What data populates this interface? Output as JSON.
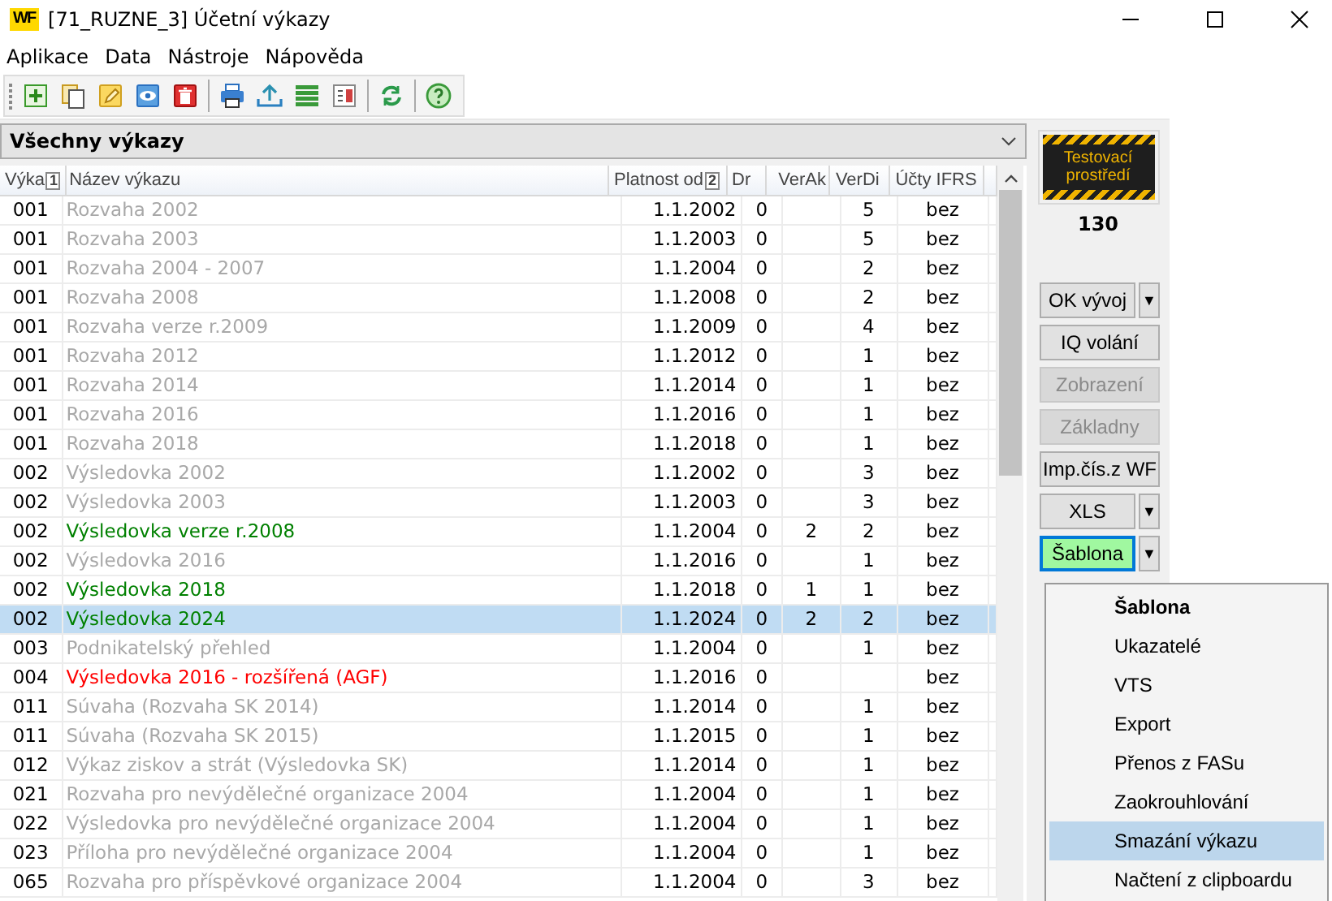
{
  "window": {
    "logo": "WF",
    "title": "[71_RUZNE_3] Účetní výkazy"
  },
  "menu": [
    "Aplikace",
    "Data",
    "Nástroje",
    "Nápověda"
  ],
  "group_header": "Všechny výkazy",
  "table": {
    "columns": [
      {
        "label": "Výka",
        "sort": "1"
      },
      {
        "label": "Název výkazu"
      },
      {
        "label": "Platnost od",
        "sort": "2"
      },
      {
        "label": "Dr"
      },
      {
        "label": "VerAk"
      },
      {
        "label": "VerDi"
      },
      {
        "label": "Účty IFRS"
      }
    ],
    "rows": [
      {
        "code": "001",
        "name": "Rozvaha 2002",
        "valid_from": "1.1.2002",
        "dr": "0",
        "ver_di": "5",
        "ifrs": "bez",
        "color": "#a8a8a8",
        "selected": false
      },
      {
        "code": "001",
        "name": "Rozvaha 2003",
        "valid_from": "1.1.2003",
        "dr": "0",
        "ver_di": "5",
        "ifrs": "bez",
        "color": "#a8a8a8",
        "selected": false
      },
      {
        "code": "001",
        "name": "Rozvaha 2004 - 2007",
        "valid_from": "1.1.2004",
        "dr": "0",
        "ver_di": "2",
        "ifrs": "bez",
        "color": "#a8a8a8",
        "selected": false
      },
      {
        "code": "001",
        "name": "Rozvaha 2008",
        "valid_from": "1.1.2008",
        "dr": "0",
        "ver_di": "2",
        "ifrs": "bez",
        "color": "#a8a8a8",
        "selected": false
      },
      {
        "code": "001",
        "name": "Rozvaha verze r.2009",
        "valid_from": "1.1.2009",
        "dr": "0",
        "ver_di": "4",
        "ifrs": "bez",
        "color": "#a8a8a8",
        "selected": false
      },
      {
        "code": "001",
        "name": "Rozvaha 2012",
        "valid_from": "1.1.2012",
        "dr": "0",
        "ver_di": "1",
        "ifrs": "bez",
        "color": "#a8a8a8",
        "selected": false
      },
      {
        "code": "001",
        "name": "Rozvaha 2014",
        "valid_from": "1.1.2014",
        "dr": "0",
        "ver_di": "1",
        "ifrs": "bez",
        "color": "#a8a8a8",
        "selected": false
      },
      {
        "code": "001",
        "name": "Rozvaha 2016",
        "valid_from": "1.1.2016",
        "dr": "0",
        "ver_di": "1",
        "ifrs": "bez",
        "color": "#a8a8a8",
        "selected": false
      },
      {
        "code": "001",
        "name": "Rozvaha 2018",
        "valid_from": "1.1.2018",
        "dr": "0",
        "ver_di": "1",
        "ifrs": "bez",
        "color": "#a8a8a8",
        "selected": false
      },
      {
        "code": "002",
        "name": "Výsledovka 2002",
        "valid_from": "1.1.2002",
        "dr": "0",
        "ver_di": "3",
        "ifrs": "bez",
        "color": "#a8a8a8",
        "selected": false
      },
      {
        "code": "002",
        "name": "Výsledovka 2003",
        "valid_from": "1.1.2003",
        "dr": "0",
        "ver_di": "3",
        "ifrs": "bez",
        "color": "#a8a8a8",
        "selected": false
      },
      {
        "code": "002",
        "name": "Výsledovka verze r.2008",
        "valid_from": "1.1.2004",
        "dr": "0",
        "ver_ak": "2",
        "ver_di": "2",
        "ifrs": "bez",
        "color": "#008000",
        "selected": false
      },
      {
        "code": "002",
        "name": "Výsledovka 2016",
        "valid_from": "1.1.2016",
        "dr": "0",
        "ver_di": "1",
        "ifrs": "bez",
        "color": "#a8a8a8",
        "selected": false
      },
      {
        "code": "002",
        "name": "Výsledovka 2018",
        "valid_from": "1.1.2018",
        "dr": "0",
        "ver_ak": "1",
        "ver_di": "1",
        "ifrs": "bez",
        "color": "#008000",
        "selected": false
      },
      {
        "code": "002",
        "name": "Výsledovka 2024",
        "valid_from": "1.1.2024",
        "dr": "0",
        "ver_ak": "2",
        "ver_di": "2",
        "ifrs": "bez",
        "color": "#008000",
        "selected": true
      },
      {
        "code": "003",
        "name": "Podnikatelský přehled",
        "valid_from": "1.1.2004",
        "dr": "0",
        "ver_di": "1",
        "ifrs": "bez",
        "color": "#a8a8a8",
        "selected": false
      },
      {
        "code": "004",
        "name": "Výsledovka 2016 - rozšířená (AGF)",
        "valid_from": "1.1.2016",
        "dr": "0",
        "ifrs": "bez",
        "color": "#ff0000",
        "selected": false
      },
      {
        "code": "011",
        "name": "Súvaha (Rozvaha SK 2014)",
        "valid_from": "1.1.2014",
        "dr": "0",
        "ver_di": "1",
        "ifrs": "bez",
        "color": "#a8a8a8",
        "selected": false
      },
      {
        "code": "011",
        "name": "Súvaha (Rozvaha SK 2015)",
        "valid_from": "1.1.2015",
        "dr": "0",
        "ver_di": "1",
        "ifrs": "bez",
        "color": "#a8a8a8",
        "selected": false
      },
      {
        "code": "012",
        "name": "Výkaz ziskov a strát (Výsledovka SK)",
        "valid_from": "1.1.2014",
        "dr": "0",
        "ver_di": "1",
        "ifrs": "bez",
        "color": "#a8a8a8",
        "selected": false
      },
      {
        "code": "021",
        "name": "Rozvaha pro nevýdělečné organizace 2004",
        "valid_from": "1.1.2004",
        "dr": "0",
        "ver_di": "1",
        "ifrs": "bez",
        "color": "#a8a8a8",
        "selected": false
      },
      {
        "code": "022",
        "name": "Výsledovka pro nevýdělečné organizace 2004",
        "valid_from": "1.1.2004",
        "dr": "0",
        "ver_di": "1",
        "ifrs": "bez",
        "color": "#a8a8a8",
        "selected": false
      },
      {
        "code": "023",
        "name": "Příloha pro nevýdělečné organizace 2004",
        "valid_from": "1.1.2004",
        "dr": "0",
        "ver_di": "1",
        "ifrs": "bez",
        "color": "#a8a8a8",
        "selected": false
      },
      {
        "code": "065",
        "name": "Rozvaha pro příspěvkové organizace 2004",
        "valid_from": "1.1.2004",
        "dr": "0",
        "ver_di": "3",
        "ifrs": "bez",
        "color": "#a8a8a8",
        "selected": false
      }
    ]
  },
  "environment_badge": "Testovací prostředí",
  "count": "130",
  "buttons": [
    {
      "label": "OK vývoj",
      "dropdown": true,
      "disabled": false,
      "focused": false
    },
    {
      "label": "IQ volání",
      "dropdown": false,
      "disabled": false,
      "focused": false
    },
    {
      "label": "Zobrazení",
      "dropdown": false,
      "disabled": true,
      "focused": false
    },
    {
      "label": "Základny",
      "dropdown": false,
      "disabled": true,
      "focused": false
    },
    {
      "label": "Imp.čís.z WF",
      "dropdown": false,
      "disabled": false,
      "focused": false
    },
    {
      "label": "XLS",
      "dropdown": true,
      "disabled": false,
      "focused": false
    },
    {
      "label": "Šablona",
      "dropdown": true,
      "disabled": false,
      "focused": true
    }
  ],
  "dropdown_arrow": "▼",
  "popup_menu": [
    {
      "label": "Šablona",
      "default": true,
      "selected": false
    },
    {
      "label": "Ukazatelé",
      "default": false,
      "selected": false
    },
    {
      "label": "VTS",
      "default": false,
      "selected": false
    },
    {
      "label": "Export",
      "default": false,
      "selected": false
    },
    {
      "label": "Přenos z FASu",
      "default": false,
      "selected": false
    },
    {
      "label": "Zaokrouhlování",
      "default": false,
      "selected": false
    },
    {
      "label": "Smazání výkazu",
      "default": false,
      "selected": true
    },
    {
      "label": "Načtení z clipboardu",
      "default": false,
      "selected": false
    }
  ]
}
